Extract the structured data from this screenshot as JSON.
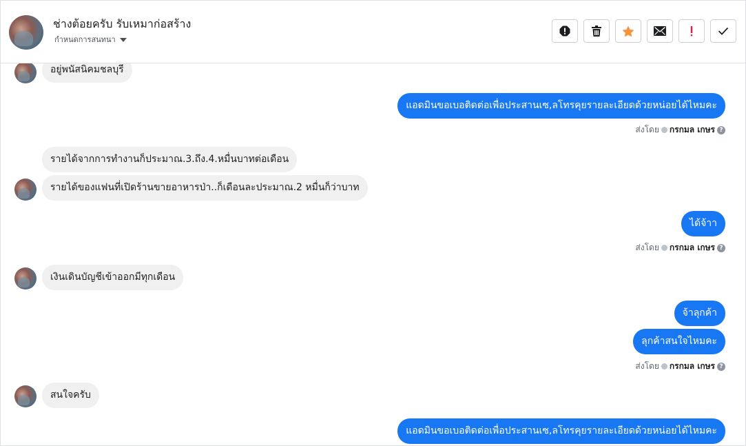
{
  "header": {
    "title": "ช่างต้อยครับ รับเหมาก่อสร้าง",
    "subtitle": "กำหนดการสนทนา",
    "toolbar": {
      "icons": [
        "spam-icon",
        "trash-icon",
        "star-icon",
        "mail-icon",
        "important-icon",
        "check-icon"
      ],
      "colors": {
        "star": "#f7923a",
        "important": "#e41e3f",
        "default": "#1c1e21"
      }
    }
  },
  "messages": {
    "m1": "อยู่พนัสนิคมชลบุรี",
    "m2": "แอดมินขอเบอติดต่อเพื่อประสานเซ,ลโทรคุยรายละเอียดด้วยหน่อยได้ไหมคะ",
    "m3": "รายได้จากการทำงานก็ประมาณ.3.ถึง.4.หมื่นบาทต่อเดือน",
    "m4": "รายได้ของแฟนที่เปิดร้านขายอาหารป่า..ก็เดือนละประมาณ.2 หมื่นก็ว่าบาท",
    "m5": "ได้จ้าา",
    "m6": "เงินเดินบัญชีเข้าออกมีทุกเดือน",
    "m7": "จ้าลุกค้า",
    "m8": "ลุกค้าสนใจไหมคะ",
    "m9": "สนใจครับ",
    "m10": "แอดมินขอเบอติดต่อเพื่อประสานเซ,ลโทรคุยรายละเอียดด้วยหน่อยได้ไหมคะ"
  },
  "sent_by": {
    "prefix": "ส่งโดย",
    "name": "กรกมล เกษร",
    "help": "?"
  },
  "colors": {
    "outgoing": "#1877f2",
    "incoming": "#f0f0f0"
  }
}
